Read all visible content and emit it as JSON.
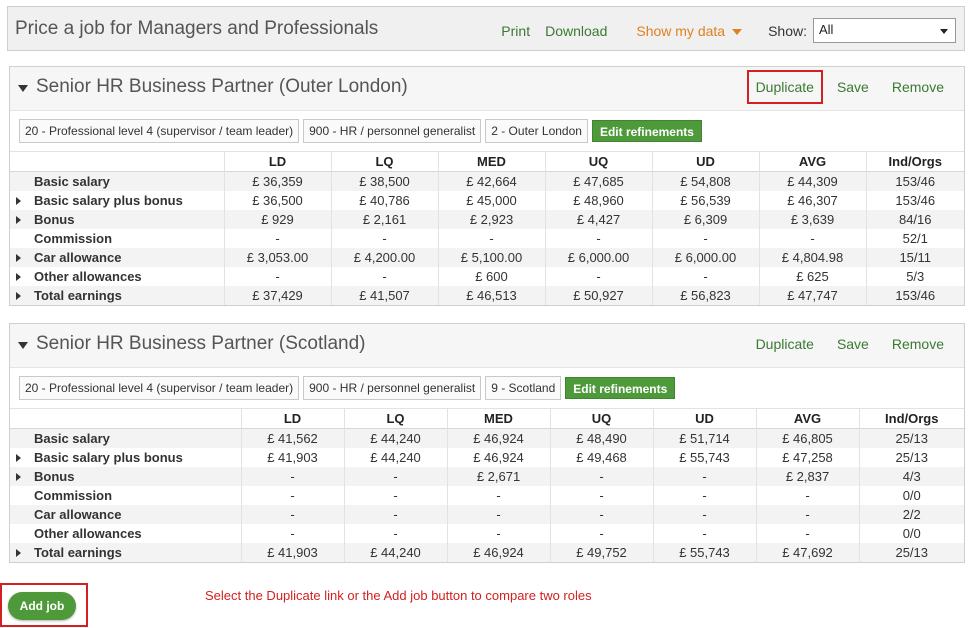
{
  "header": {
    "title": "Price a job for Managers and Professionals",
    "print": "Print",
    "download": "Download",
    "show_my_data": "Show my data",
    "show_label": "Show:",
    "show_value": "All"
  },
  "actions": {
    "duplicate": "Duplicate",
    "save": "Save",
    "remove": "Remove"
  },
  "edit_refinements": "Edit refinements",
  "columns": [
    "LD",
    "LQ",
    "MED",
    "UQ",
    "UD",
    "AVG",
    "Ind/Orgs"
  ],
  "jobs": [
    {
      "title": "Senior HR Business Partner (Outer London)",
      "chips": [
        "20 - Professional level 4 (supervisor / team leader)",
        "900 - HR / personnel generalist",
        "2 - Outer London"
      ],
      "rows": [
        {
          "label": "Basic salary",
          "expandable": false,
          "values": [
            "£ 36,359",
            "£ 38,500",
            "£ 42,664",
            "£ 47,685",
            "£ 54,808",
            "£ 44,309",
            "153/46"
          ]
        },
        {
          "label": "Basic salary plus bonus",
          "expandable": true,
          "values": [
            "£ 36,500",
            "£ 40,786",
            "£ 45,000",
            "£ 48,960",
            "£ 56,539",
            "£ 46,307",
            "153/46"
          ]
        },
        {
          "label": "Bonus",
          "expandable": true,
          "values": [
            "£ 929",
            "£ 2,161",
            "£ 2,923",
            "£ 4,427",
            "£ 6,309",
            "£ 3,639",
            "84/16"
          ]
        },
        {
          "label": "Commission",
          "expandable": false,
          "values": [
            "-",
            "-",
            "-",
            "-",
            "-",
            "-",
            "52/1"
          ]
        },
        {
          "label": "Car allowance",
          "expandable": true,
          "values": [
            "£ 3,053.00",
            "£ 4,200.00",
            "£ 5,100.00",
            "£ 6,000.00",
            "£ 6,000.00",
            "£ 4,804.98",
            "15/11"
          ]
        },
        {
          "label": "Other allowances",
          "expandable": true,
          "values": [
            "-",
            "-",
            "£ 600",
            "-",
            "-",
            "£ 625",
            "5/3"
          ]
        },
        {
          "label": "Total earnings",
          "expandable": true,
          "values": [
            "£ 37,429",
            "£ 41,507",
            "£ 46,513",
            "£ 50,927",
            "£ 56,823",
            "£ 47,747",
            "153/46"
          ]
        }
      ]
    },
    {
      "title": "Senior HR Business Partner (Scotland)",
      "chips": [
        "20 - Professional level 4 (supervisor / team leader)",
        "900 - HR / personnel generalist",
        "9 - Scotland"
      ],
      "rows": [
        {
          "label": "Basic salary",
          "expandable": false,
          "values": [
            "£ 41,562",
            "£ 44,240",
            "£ 46,924",
            "£ 48,490",
            "£ 51,714",
            "£ 46,805",
            "25/13"
          ]
        },
        {
          "label": "Basic salary plus bonus",
          "expandable": true,
          "values": [
            "£ 41,903",
            "£ 44,240",
            "£ 46,924",
            "£ 49,468",
            "£ 55,743",
            "£ 47,258",
            "25/13"
          ]
        },
        {
          "label": "Bonus",
          "expandable": true,
          "values": [
            "-",
            "-",
            "£ 2,671",
            "-",
            "-",
            "£ 2,837",
            "4/3"
          ]
        },
        {
          "label": "Commission",
          "expandable": false,
          "values": [
            "-",
            "-",
            "-",
            "-",
            "-",
            "-",
            "0/0"
          ]
        },
        {
          "label": "Car allowance",
          "expandable": false,
          "values": [
            "-",
            "-",
            "-",
            "-",
            "-",
            "-",
            "2/2"
          ]
        },
        {
          "label": "Other allowances",
          "expandable": false,
          "values": [
            "-",
            "-",
            "-",
            "-",
            "-",
            "-",
            "0/0"
          ]
        },
        {
          "label": "Total earnings",
          "expandable": true,
          "values": [
            "£ 41,903",
            "£ 44,240",
            "£ 46,924",
            "£ 49,752",
            "£ 55,743",
            "£ 47,692",
            "25/13"
          ]
        }
      ]
    }
  ],
  "add_job": "Add job",
  "instruction": "Select the Duplicate link or the Add job button to compare two roles",
  "colors": {
    "link_green": "#3a7a32",
    "button_green": "#4e9a3b",
    "highlight_red": "#d32020",
    "orange": "#e08020"
  }
}
